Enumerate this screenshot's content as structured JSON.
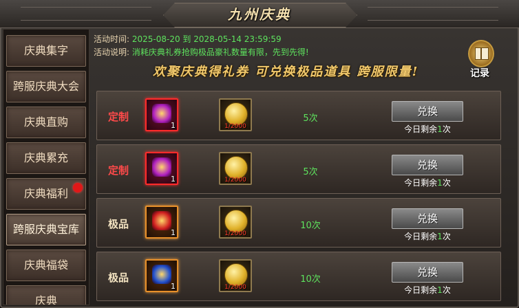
{
  "window": {
    "title": "九州庆典"
  },
  "sidebar": {
    "items": [
      {
        "label": "庆典集字"
      },
      {
        "label": "跨服庆典大会"
      },
      {
        "label": "庆典直购"
      },
      {
        "label": "庆典累充"
      },
      {
        "label": "庆典福利"
      },
      {
        "label": "跨服庆典宝库"
      },
      {
        "label": "庆典福袋"
      },
      {
        "label": "庆典"
      }
    ],
    "active_index": 5,
    "notification_item_index": 4
  },
  "info": {
    "time_key": "活动时间:",
    "time_value": "2025-08-20 到 2028-05-14 23:59:59",
    "desc_key": "活动说明:",
    "desc_value": "消耗庆典礼券抢购极品豪礼数量有限，先到先得!"
  },
  "banner": {
    "text": "欢聚庆典得礼券 可兑换极品道具 跨服限量!"
  },
  "record_button": {
    "label": "记录",
    "icon": "book-icon"
  },
  "rows": [
    {
      "tier": "定制",
      "tier_color": "#ff4a4a",
      "item_qty": "1",
      "item_color": "#b020c0",
      "cost": "1/2000",
      "count": "5次",
      "button": "兑换",
      "remain_prefix": "今日剩余",
      "remain_num": "1",
      "remain_suffix": "次"
    },
    {
      "tier": "定制",
      "tier_color": "#ff4a4a",
      "item_qty": "1",
      "item_color": "#b020c0",
      "cost": "1/2000",
      "count": "5次",
      "button": "兑换",
      "remain_prefix": "今日剩余",
      "remain_num": "1",
      "remain_suffix": "次"
    },
    {
      "tier": "极品",
      "tier_color": "#f2e2c0",
      "item_qty": "1",
      "item_color": "#d02020",
      "cost": "1/2000",
      "count": "10次",
      "button": "兑换",
      "remain_prefix": "今日剩余",
      "remain_num": "1",
      "remain_suffix": "次"
    },
    {
      "tier": "极品",
      "tier_color": "#f2e2c0",
      "item_qty": "1",
      "item_color": "#2050d0",
      "cost": "1/2000",
      "count": "10次",
      "button": "兑换",
      "remain_prefix": "今日剩余",
      "remain_num": "1",
      "remain_suffix": "次"
    }
  ],
  "colors": {
    "value_green": "#5ee35e",
    "banner_gold": "#f0c86c",
    "notification_red": "#e01818"
  }
}
